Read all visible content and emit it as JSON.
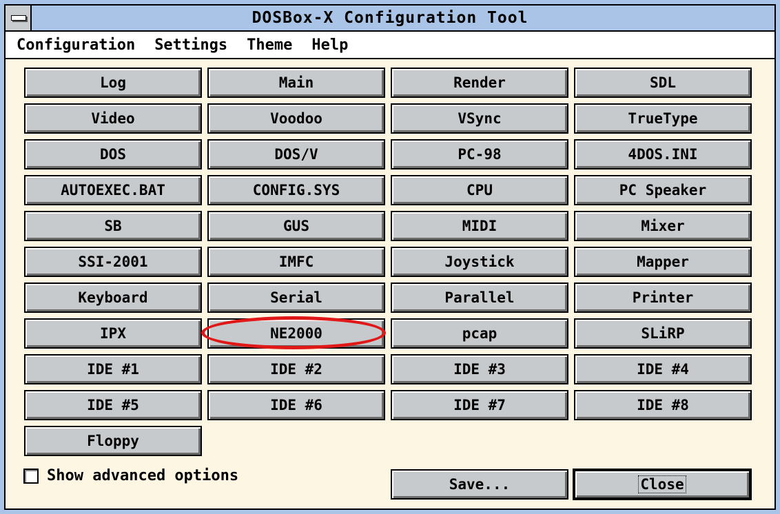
{
  "window": {
    "title": "DOSBox-X Configuration Tool"
  },
  "menubar": {
    "items": [
      "Configuration",
      "Settings",
      "Theme",
      "Help"
    ]
  },
  "sections": [
    "Log",
    "Main",
    "Render",
    "SDL",
    "Video",
    "Voodoo",
    "VSync",
    "TrueType",
    "DOS",
    "DOS/V",
    "PC-98",
    "4DOS.INI",
    "AUTOEXEC.BAT",
    "CONFIG.SYS",
    "CPU",
    "PC Speaker",
    "SB",
    "GUS",
    "MIDI",
    "Mixer",
    "SSI-2001",
    "IMFC",
    "Joystick",
    "Mapper",
    "Keyboard",
    "Serial",
    "Parallel",
    "Printer",
    "IPX",
    "NE2000",
    "pcap",
    "SLiRP",
    "IDE #1",
    "IDE #2",
    "IDE #3",
    "IDE #4",
    "IDE #5",
    "IDE #6",
    "IDE #7",
    "IDE #8",
    "Floppy"
  ],
  "highlighted_section": "NE2000",
  "footer": {
    "advanced_label": "Show advanced options",
    "advanced_checked": false,
    "save_label": "Save...",
    "close_label": "Close"
  },
  "colors": {
    "desktop": "#a9c4e6",
    "window_bg": "#fdf6e3",
    "button_face": "#c6cacd",
    "highlight": "#e01818"
  }
}
